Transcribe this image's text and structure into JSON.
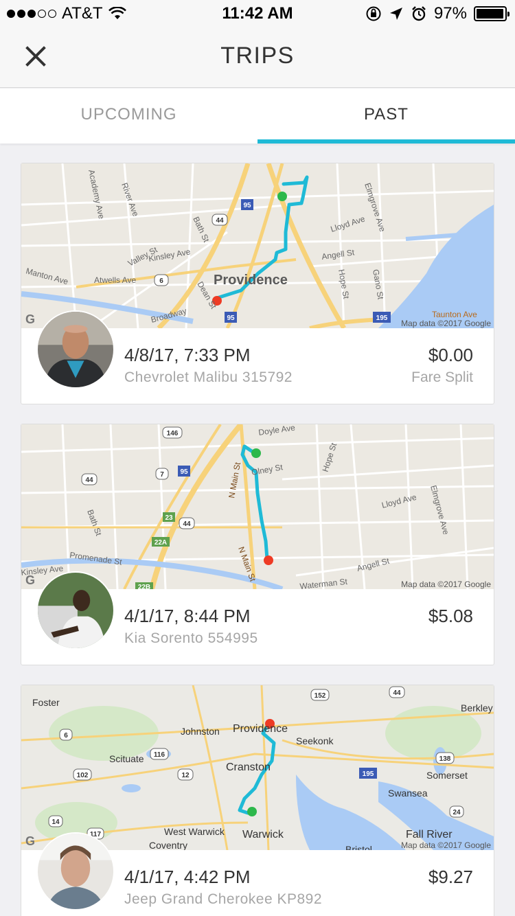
{
  "status_bar": {
    "carrier": "AT&T",
    "time": "11:42 AM",
    "battery": "97%",
    "battery_level": 0.97
  },
  "header": {
    "title": "TRIPS",
    "close_icon": "close-icon"
  },
  "tabs": [
    {
      "label": "UPCOMING",
      "active": false
    },
    {
      "label": "PAST",
      "active": true
    }
  ],
  "accent_color": "#1fbad6",
  "trips": [
    {
      "date": "4/8/17, 7:33 PM",
      "car": "Chevrolet Malibu 315792",
      "fare": "$0.00",
      "note": "Fare Split",
      "map": {
        "credit": "Map data ©2017 Google",
        "labels": [
          "Providence",
          "Academy Ave",
          "River Ave",
          "Bath St",
          "Valley St",
          "Kinsley Ave",
          "Manton Ave",
          "Atwells Ave",
          "Dean St",
          "Broadway",
          "Lloyd Ave",
          "Elmgrove Ave",
          "Angell St",
          "Hope St",
          "Gano St",
          "Taunton Ave"
        ],
        "shields": [
          "95",
          "44",
          "6",
          "95",
          "195"
        ]
      }
    },
    {
      "date": "4/1/17, 8:44 PM",
      "car": "Kia Sorento 554995",
      "fare": "$5.08",
      "note": "",
      "map": {
        "credit": "Map data ©2017 Google",
        "labels": [
          "Doyle Ave",
          "Hope St",
          "Olney St",
          "N Main St",
          "Lloyd Ave",
          "Elmgrove Ave",
          "Bath St",
          "Promenade St",
          "Kinsley Ave",
          "Angell St",
          "Waterman St",
          "N Main St"
        ],
        "shields": [
          "146",
          "95",
          "7",
          "44",
          "23",
          "44",
          "22A",
          "22B"
        ]
      }
    },
    {
      "date": "4/1/17, 4:42 PM",
      "car": "Jeep Grand Cherokee KP892",
      "fare": "$9.27",
      "note": "",
      "map": {
        "credit": "Map data ©2017 Google",
        "labels": [
          "Foster",
          "Johnston",
          "Providence",
          "Seekonk",
          "Berkley",
          "Scituate",
          "Cranston",
          "Somerset",
          "Swansea",
          "West Warwick",
          "Warwick",
          "Coventry",
          "Fall River",
          "Bristol"
        ],
        "shields": [
          "152",
          "44",
          "6",
          "116",
          "102",
          "12",
          "138",
          "195",
          "14",
          "117",
          "24"
        ]
      }
    }
  ]
}
